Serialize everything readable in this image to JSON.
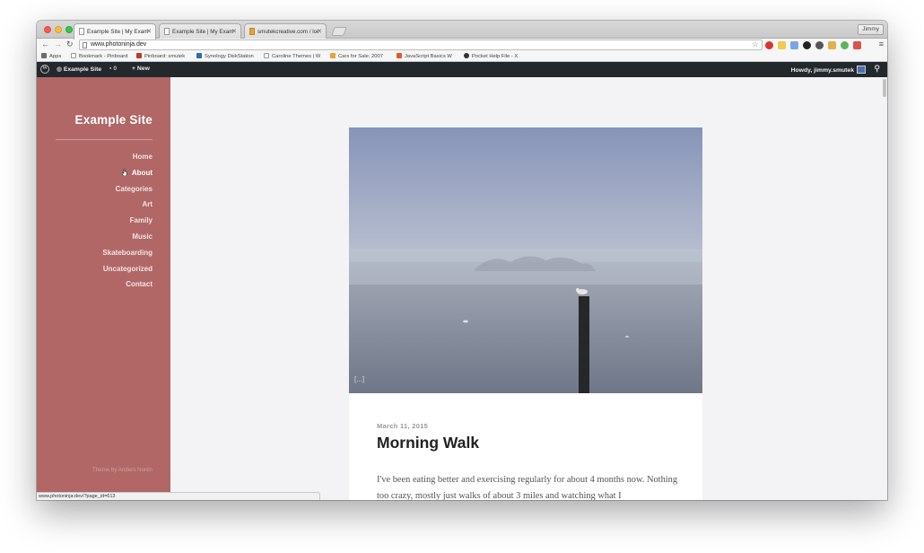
{
  "browser": {
    "tabs": [
      {
        "label": "Example Site | My Exampl",
        "active": true
      },
      {
        "label": "Example Site | My Exampl",
        "active": false
      },
      {
        "label": "smutekcreative.com / loca",
        "active": false
      }
    ],
    "user": "Jimmy",
    "url": "www.photoninja.dev",
    "bookmarks": [
      {
        "label": "Apps",
        "icon": "apps-grid-icon",
        "color": "#6b6b6b"
      },
      {
        "label": "Bookmark - Pinboard",
        "icon": "page-icon",
        "color": "#ffffff"
      },
      {
        "label": "Pinboard: smutek",
        "icon": "pinboard-icon",
        "color": "#c0392b"
      },
      {
        "label": "Synology DiskStation",
        "icon": "synology-icon",
        "color": "#2b6cb0"
      },
      {
        "label": "Caroline Themes | W",
        "icon": "page-icon",
        "color": "#ffffff"
      },
      {
        "label": "Cars for Sale: 2007",
        "icon": "cars-icon",
        "color": "#e8a235"
      },
      {
        "label": "JavaScript Basics W",
        "icon": "javascript-icon",
        "color": "#e05a2b"
      },
      {
        "label": "Pocket Help File - X",
        "icon": "pocket-icon",
        "color": "#333333"
      }
    ]
  },
  "adminbar": {
    "site_name": "Example Site",
    "comments_count": "0",
    "new_label": "New",
    "greeting": "Howdy, jimmy.smutek"
  },
  "sidebar": {
    "site_title": "Example Site",
    "menu": [
      "Home",
      "About",
      "Categories",
      "Art",
      "Family",
      "Music",
      "Skateboarding",
      "Uncategorized",
      "Contact"
    ],
    "credit": "Theme by Anders Norén",
    "bg_color": "#b26767"
  },
  "status_bar": {
    "text": "www.photoninja.dev/?page_id=613"
  },
  "post": {
    "date": "March 11, 2015",
    "title": "Morning Walk",
    "excerpt": "I've been eating better and exercising regularly for about 4 months now. Nothing too crazy, mostly just walks of about 3 miles and watching what I",
    "more_link": "[...]"
  }
}
